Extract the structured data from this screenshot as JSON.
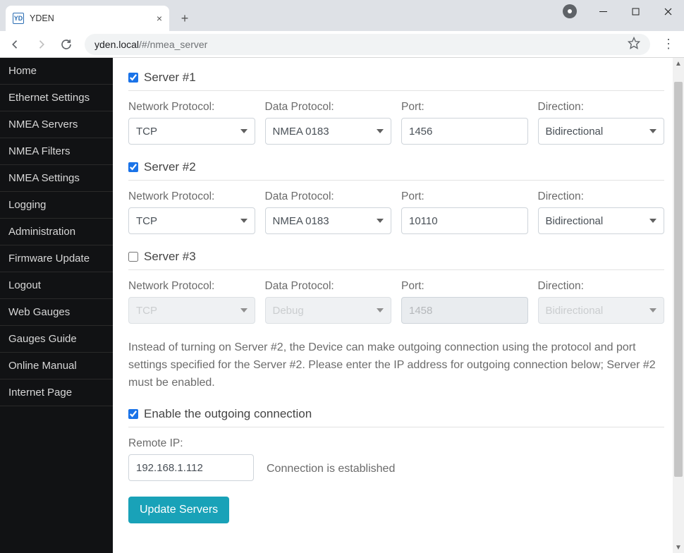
{
  "browser": {
    "tab_title": "YDEN",
    "favicon_text": "YD",
    "url_host": "yden.local",
    "url_path": "/#/nmea_server"
  },
  "sidebar": {
    "items": [
      "Home",
      "Ethernet Settings",
      "NMEA Servers",
      "NMEA Filters",
      "NMEA Settings",
      "Logging",
      "Administration",
      "Firmware Update",
      "Logout",
      "Web Gauges",
      "Gauges Guide",
      "Online Manual",
      "Internet Page"
    ]
  },
  "labels": {
    "network_protocol": "Network Protocol:",
    "data_protocol": "Data Protocol:",
    "port": "Port:",
    "direction": "Direction:"
  },
  "servers": [
    {
      "title": "Server #1",
      "enabled": true,
      "network_protocol": "TCP",
      "data_protocol": "NMEA 0183",
      "port": "1456",
      "direction": "Bidirectional"
    },
    {
      "title": "Server #2",
      "enabled": true,
      "network_protocol": "TCP",
      "data_protocol": "NMEA 0183",
      "port": "10110",
      "direction": "Bidirectional"
    },
    {
      "title": "Server #3",
      "enabled": false,
      "network_protocol": "TCP",
      "data_protocol": "Debug",
      "port": "1458",
      "direction": "Bidirectional"
    }
  ],
  "paragraph": "Instead of turning on Server #2, the Device can make outgoing connection using the protocol and port settings specified for the Server #2. Please enter the IP address for outgoing connection below; Server #2 must be enabled.",
  "outgoing": {
    "checkbox_label": "Enable the outgoing connection",
    "enabled": true,
    "remote_ip_label": "Remote IP:",
    "remote_ip": "192.168.1.112",
    "status": "Connection is established"
  },
  "update_button": "Update Servers"
}
